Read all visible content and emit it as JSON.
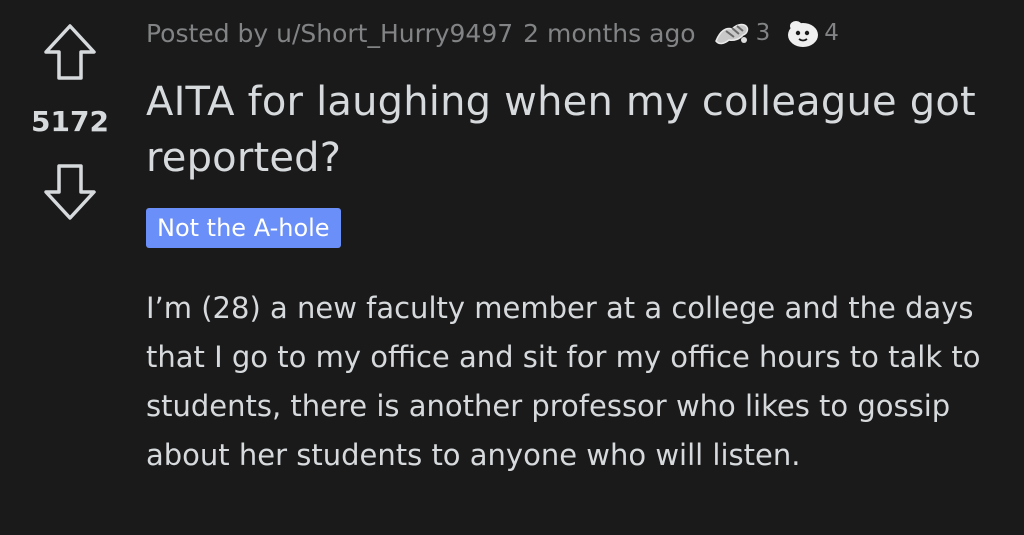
{
  "post": {
    "score": "5172",
    "posted_by": "Posted by u/Short_Hurry9497",
    "time_ago": "2 months ago",
    "awards": [
      {
        "icon": "arm-wrestle-award-icon",
        "count": "3"
      },
      {
        "icon": "wholesome-seal-award-icon",
        "count": "4"
      }
    ],
    "title": "AITA for laughing when my colleague got reported?",
    "flair": "Not the A-hole",
    "body": "I’m (28) a new faculty member at a college and the days that I go to my office and sit for my office hours to talk to students, there is another professor who likes to gossip about her students to anyone who will listen."
  },
  "colors": {
    "background": "#1a1a1b",
    "text": "#d7dadc",
    "meta_text": "#818384",
    "flair_background": "#6a8ff8",
    "flair_text": "#ffffff"
  },
  "icons": {
    "upvote": "upvote-arrow-icon",
    "downvote": "downvote-arrow-icon"
  }
}
